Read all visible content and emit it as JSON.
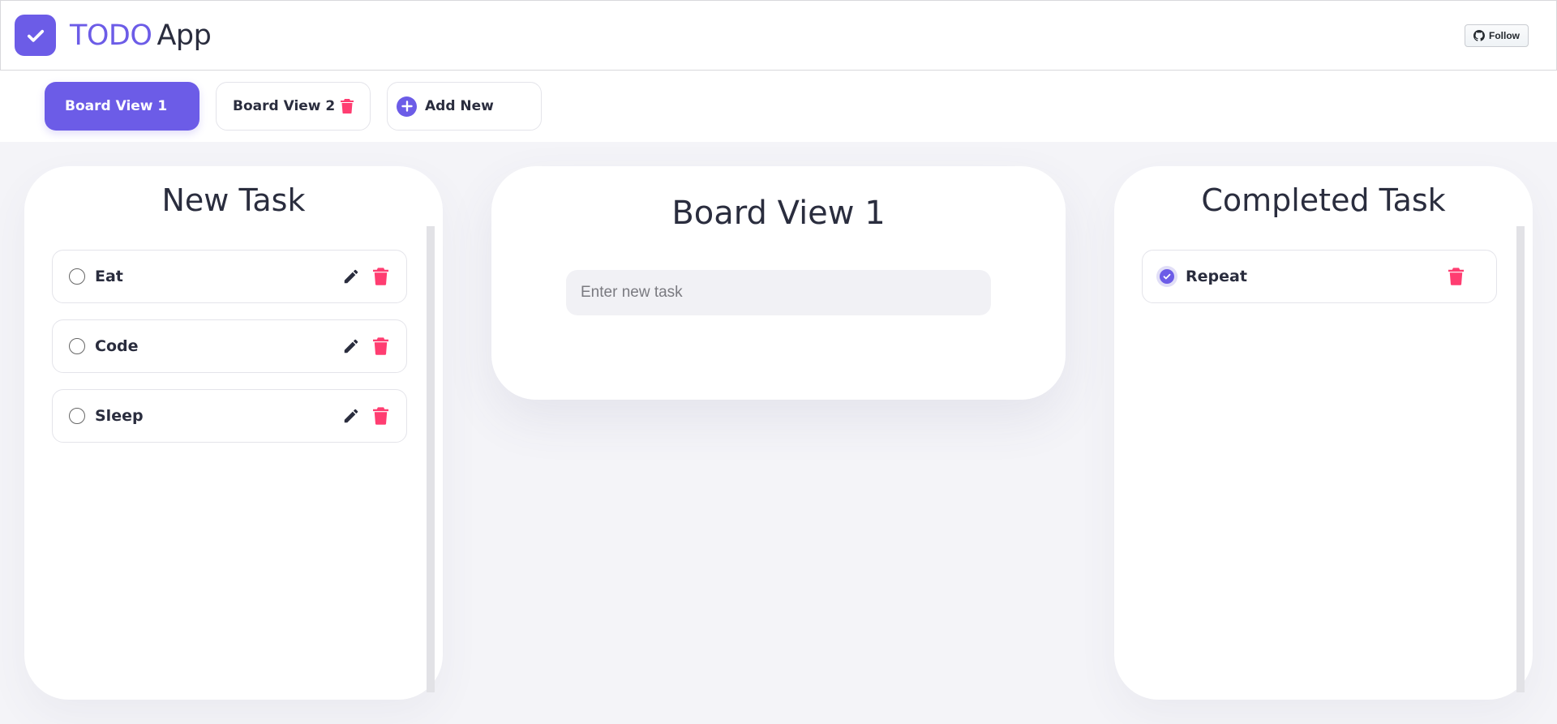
{
  "header": {
    "brand_todo": "TODO",
    "brand_app": "App",
    "follow_label": "Follow"
  },
  "tabs": [
    {
      "label": "Board View 1",
      "active": true
    },
    {
      "label": "Board View 2",
      "active": false
    },
    {
      "label": "Add New",
      "active": false
    }
  ],
  "new_task_panel": {
    "title": "New Task",
    "items": [
      {
        "label": "Eat",
        "done": false
      },
      {
        "label": "Code",
        "done": false
      },
      {
        "label": "Sleep",
        "done": false
      }
    ]
  },
  "board_panel": {
    "title": "Board View 1",
    "input_placeholder": "Enter new task",
    "input_value": ""
  },
  "completed_panel": {
    "title": "Completed Task",
    "items": [
      {
        "label": "Repeat",
        "done": true
      }
    ]
  },
  "colors": {
    "accent": "#6c5ce7",
    "delete": "#ff3d71",
    "text": "#2a2d3e",
    "background": "#f4f4f8"
  },
  "icons": [
    "check-icon",
    "github-icon",
    "trash-icon",
    "plus-icon",
    "pencil-icon",
    "radio-icon",
    "checked-circle-icon"
  ]
}
